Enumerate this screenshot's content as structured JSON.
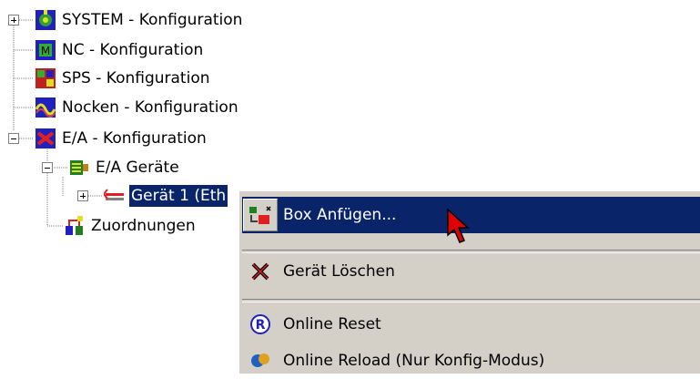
{
  "tree": {
    "items": [
      {
        "label": "SYSTEM - Konfiguration",
        "icon": "system-config-icon"
      },
      {
        "label": "NC - Konfiguration",
        "icon": "nc-config-icon"
      },
      {
        "label": "SPS - Konfiguration",
        "icon": "sps-config-icon"
      },
      {
        "label": "Nocken - Konfiguration",
        "icon": "cam-config-icon"
      },
      {
        "label": "E/A - Konfiguration",
        "icon": "io-config-icon"
      },
      {
        "label": "E/A Geräte",
        "icon": "io-devices-icon"
      },
      {
        "label": "Gerät 1 (Eth",
        "icon": "ethercat-device-icon"
      },
      {
        "label": "Zuordnungen",
        "icon": "mappings-icon"
      }
    ]
  },
  "context_menu": {
    "items": [
      {
        "label": "Box Anfügen...",
        "icon": "add-box-icon"
      },
      {
        "label": "Gerät Löschen",
        "icon": "delete-device-icon"
      },
      {
        "label": "Online Reset",
        "icon": "online-reset-icon"
      },
      {
        "label": "Online Reload (Nur Konfig-Modus)",
        "icon": "online-reload-icon"
      }
    ]
  },
  "colors": {
    "selection": "#0a246a",
    "menu_background": "#d4d0c8",
    "cursor": "#e00000"
  }
}
